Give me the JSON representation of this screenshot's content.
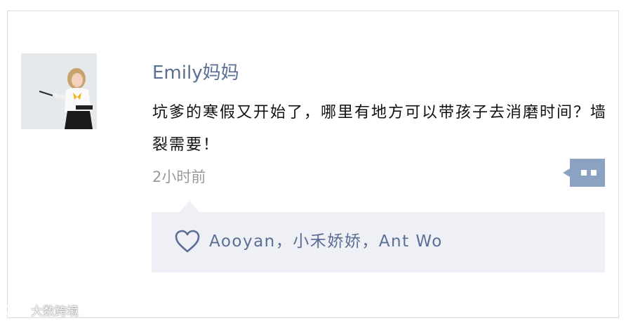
{
  "post": {
    "username": "Emily妈妈",
    "content": "坑爹的寒假又开始了，哪里有地方可以带孩子去消磨时间？墙裂需要！",
    "timestamp": "2小时前",
    "avatar_icon": "person-photo",
    "more_icon": "ellipsis-bubble-icon"
  },
  "likes": {
    "icon": "heart-outline-icon",
    "names": "Aooyan，小禾娇娇，Ant Wo"
  },
  "watermark": {
    "text": "大数跨境"
  },
  "colors": {
    "username": "#5b6f95",
    "accent": "#8ba2c3",
    "like_panel_bg": "#eef0f5",
    "timestamp": "#9a9a9a"
  }
}
